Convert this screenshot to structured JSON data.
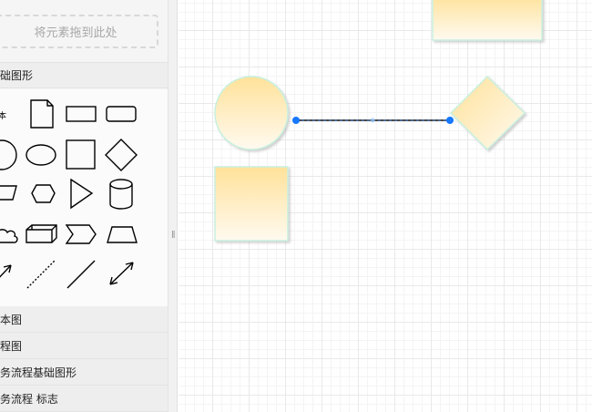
{
  "sidebar": {
    "dropzone_text": "将元素拖到此处",
    "sections": [
      {
        "label": "础图形"
      },
      {
        "label": "本图"
      },
      {
        "label": "程图"
      },
      {
        "label": "务流程基础图形"
      },
      {
        "label": "务流程 标志"
      }
    ],
    "palette": {
      "text_shape_label": "本"
    }
  },
  "splitter": {
    "grip": "||"
  },
  "colors": {
    "shape_fill_top": "#ffe29a",
    "shape_fill_bottom": "#fffaf0",
    "shape_stroke": "#c8f0df",
    "connector": "#111111",
    "handle": "#1677ff"
  }
}
